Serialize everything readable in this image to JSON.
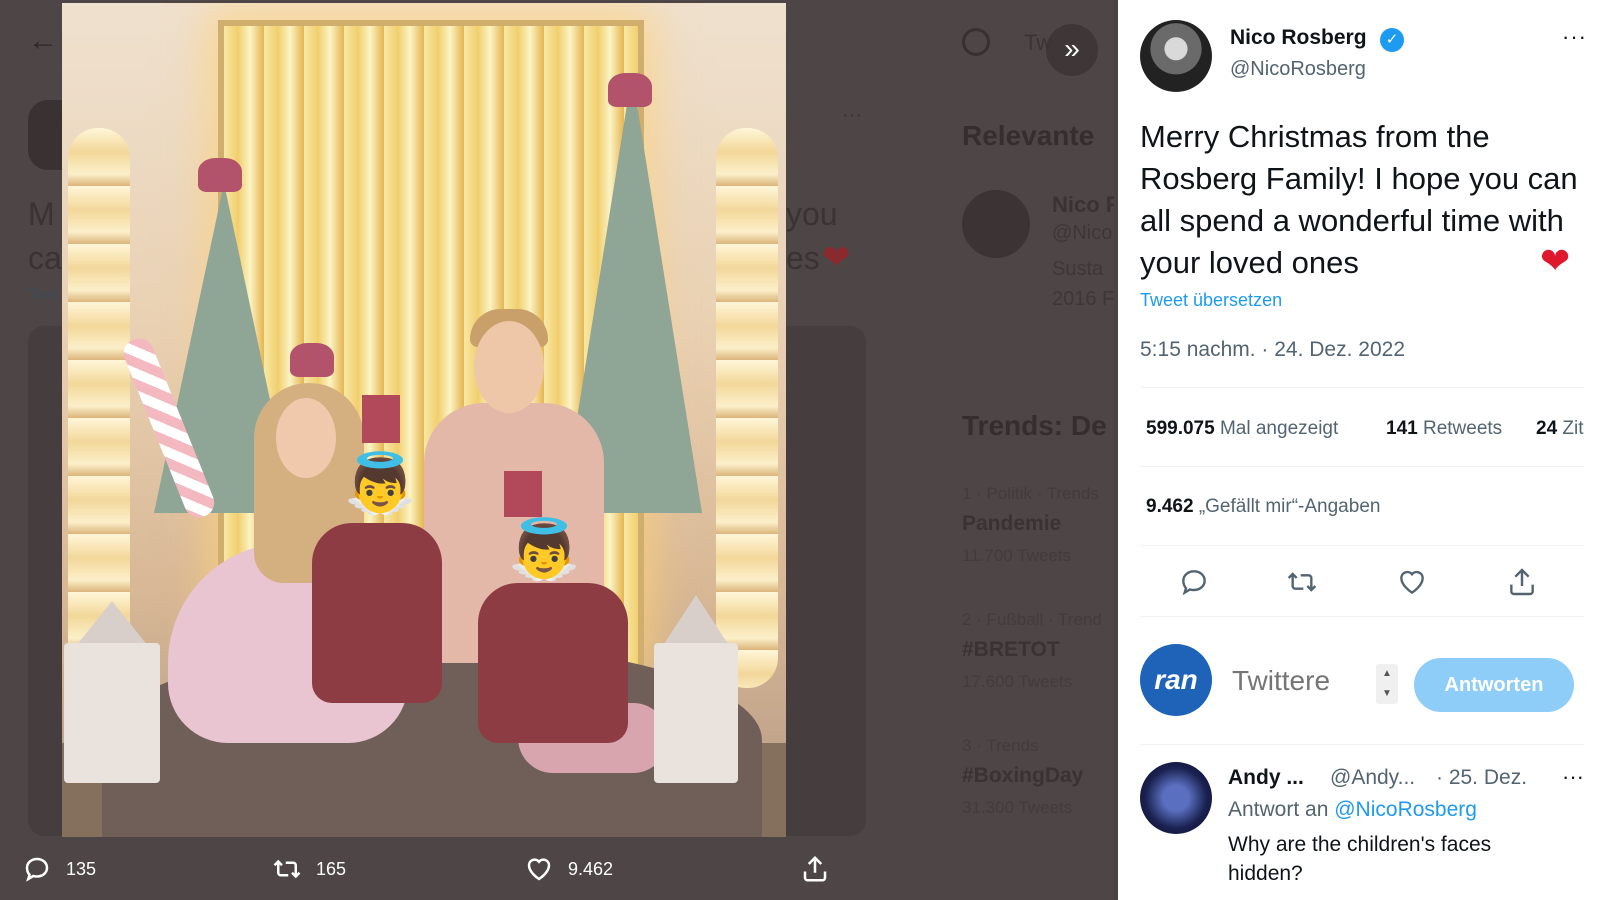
{
  "colors": {
    "accent": "#1d9bf0",
    "heart": "#e0182d",
    "reply_button": "#8ecdf8",
    "muted": "#536471"
  },
  "background": {
    "back_arrow": "←",
    "lead_text_1": "M",
    "lead_text_2": "ca",
    "lead_link": "Twe",
    "more_dots": "···",
    "you_fragment": "you",
    "es_fragment": "es",
    "search_fragment": "Tw",
    "relevant_heading": "Relevante",
    "card_name": "Nico R",
    "card_handle": "@Nico",
    "card_line1": "Susta",
    "card_line2": "2016 F",
    "trends_heading": "Trends: De",
    "trends": [
      {
        "meta": "1 · Politik · Trends",
        "name": "Pandemie",
        "count": "11.700 Tweets"
      },
      {
        "meta": "2 · Fußball · Trend",
        "name": "#BRETOT",
        "count": "17.600 Tweets"
      },
      {
        "meta": "3 · Trends",
        "name": "#BoxingDay",
        "count": "31.300 Tweets"
      }
    ]
  },
  "media": {
    "next_icon": "»"
  },
  "media_actions": {
    "reply_count": "135",
    "retweet_count": "165",
    "like_count": "9.462"
  },
  "tweet": {
    "author_name": "Nico Rosberg",
    "author_handle": "@NicoRosberg",
    "verified_icon": "✓",
    "more_icon": "···",
    "text": "Merry Christmas from the Rosberg Family! I hope you can all spend a wonderful time with your loved ones",
    "emoji": "❤",
    "translate_link": "Tweet übersetzen",
    "timestamp": "5:15 nachm. · 24. Dez. 2022",
    "stats": {
      "views_count": "599.075",
      "views_label": "Mal angezeigt",
      "retweets_count": "141",
      "retweets_label": "Retweets",
      "quotes_count": "24",
      "quotes_label": "Zit",
      "likes_count": "9.462",
      "likes_label": "„Gefällt mir“-Angaben"
    }
  },
  "reply_box": {
    "logo_text": "ran",
    "placeholder": "Twittere",
    "button_label": "Antworten"
  },
  "reply": {
    "name": "Andy ...",
    "handle": "@Andy...",
    "date": "· 25. Dez.",
    "more_icon": "···",
    "reply_to_label": "Antwort an",
    "reply_to_handle": "@NicoRosberg",
    "text": "Why are the children's faces hidden?"
  }
}
